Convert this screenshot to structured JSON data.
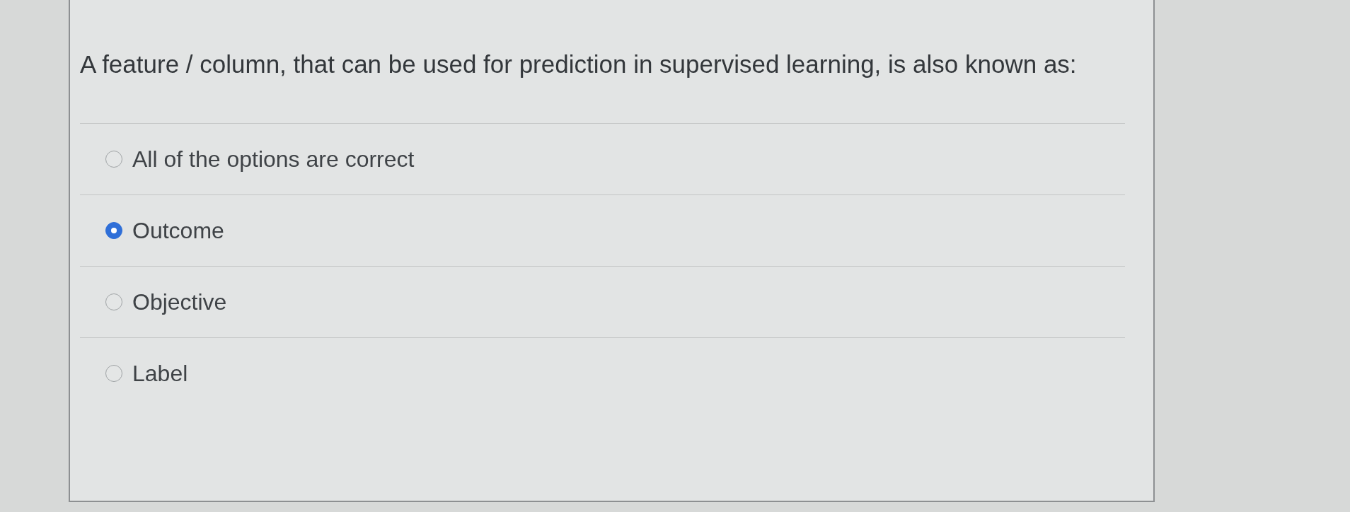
{
  "question": {
    "text": "A feature / column, that can be used for prediction in supervised learning, is also known as:",
    "options": [
      {
        "label": "All of the options are correct",
        "selected": false
      },
      {
        "label": "Outcome",
        "selected": true
      },
      {
        "label": "Objective",
        "selected": false
      },
      {
        "label": "Label",
        "selected": false
      }
    ]
  }
}
